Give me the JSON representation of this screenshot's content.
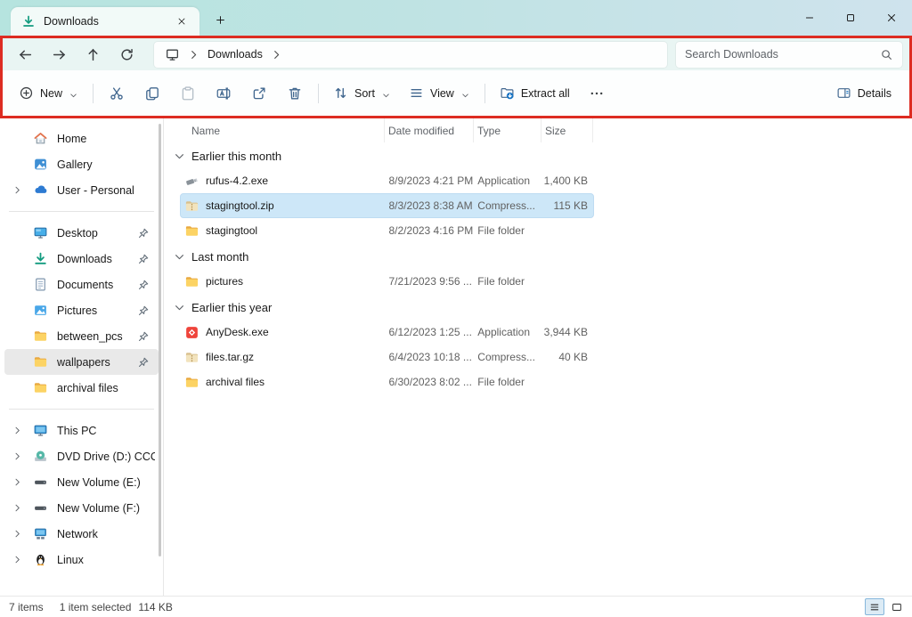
{
  "titlebar": {
    "tab_title": "Downloads",
    "tab_icon": "downloads-icon"
  },
  "addressbar": {
    "location": "Downloads",
    "search_placeholder": "Search Downloads"
  },
  "toolbar": {
    "new_label": "New",
    "sort_label": "Sort",
    "view_label": "View",
    "extract_label": "Extract all",
    "details_label": "Details"
  },
  "colors": {
    "highlight_red": "#dd2c22",
    "selection_blue": "#cde7f8",
    "titlebar_teal": "#b6e4df",
    "accent_blue": "#41678f"
  },
  "sidebar": {
    "items": [
      {
        "label": "Home",
        "icon": "home-icon"
      },
      {
        "label": "Gallery",
        "icon": "gallery-icon"
      },
      {
        "label": "User - Personal",
        "icon": "cloud-icon",
        "chevron": true
      },
      {
        "type": "divider"
      },
      {
        "label": "Desktop",
        "icon": "desktop-icon",
        "pinned": true
      },
      {
        "label": "Downloads",
        "icon": "downloads-icon",
        "pinned": true
      },
      {
        "label": "Documents",
        "icon": "document-icon",
        "pinned": true
      },
      {
        "label": "Pictures",
        "icon": "pictures-icon",
        "pinned": true
      },
      {
        "label": "between_pcs",
        "icon": "folder-icon",
        "pinned": true
      },
      {
        "label": "wallpapers",
        "icon": "folder-icon",
        "pinned": true,
        "selected": true
      },
      {
        "label": "archival files",
        "icon": "folder-icon"
      },
      {
        "type": "divider"
      },
      {
        "label": "This PC",
        "icon": "thispc-icon",
        "chevron": true
      },
      {
        "label": "DVD Drive (D:) CCCOMA_",
        "icon": "dvd-icon",
        "chevron": true
      },
      {
        "label": "New Volume (E:)",
        "icon": "drive-icon",
        "chevron": true
      },
      {
        "label": "New Volume (F:)",
        "icon": "drive-icon",
        "chevron": true
      },
      {
        "label": "Network",
        "icon": "network-icon",
        "chevron": true
      },
      {
        "label": "Linux",
        "icon": "linux-icon",
        "chevron": true
      }
    ]
  },
  "files": {
    "columns": [
      "Name",
      "Date modified",
      "Type",
      "Size"
    ],
    "groups": [
      {
        "label": "Earlier this month",
        "rows": [
          {
            "name": "rufus-4.2.exe",
            "date": "8/9/2023 4:21 PM",
            "type": "Application",
            "size": "1,400 KB",
            "icon": "usb-file-icon"
          },
          {
            "name": "stagingtool.zip",
            "date": "8/3/2023 8:38 AM",
            "type": "Compress...",
            "size": "115 KB",
            "icon": "zip-file-icon",
            "selected": true
          },
          {
            "name": "stagingtool",
            "date": "8/2/2023 4:16 PM",
            "type": "File folder",
            "size": "",
            "icon": "folder-icon"
          }
        ]
      },
      {
        "label": "Last month",
        "rows": [
          {
            "name": "pictures",
            "date": "7/21/2023 9:56 ...",
            "type": "File folder",
            "size": "",
            "icon": "folder-icon"
          }
        ]
      },
      {
        "label": "Earlier this year",
        "rows": [
          {
            "name": "AnyDesk.exe",
            "date": "6/12/2023 1:25 ...",
            "type": "Application",
            "size": "3,944 KB",
            "icon": "anydesk-icon"
          },
          {
            "name": "files.tar.gz",
            "date": "6/4/2023 10:18 ...",
            "type": "Compress...",
            "size": "40 KB",
            "icon": "zip-file-icon"
          },
          {
            "name": "archival files",
            "date": "6/30/2023 8:02 ...",
            "type": "File folder",
            "size": "",
            "icon": "folder-icon"
          }
        ]
      }
    ]
  },
  "statusbar": {
    "items_count": "7 items",
    "selection": "1 item selected",
    "selection_size": "114 KB"
  }
}
